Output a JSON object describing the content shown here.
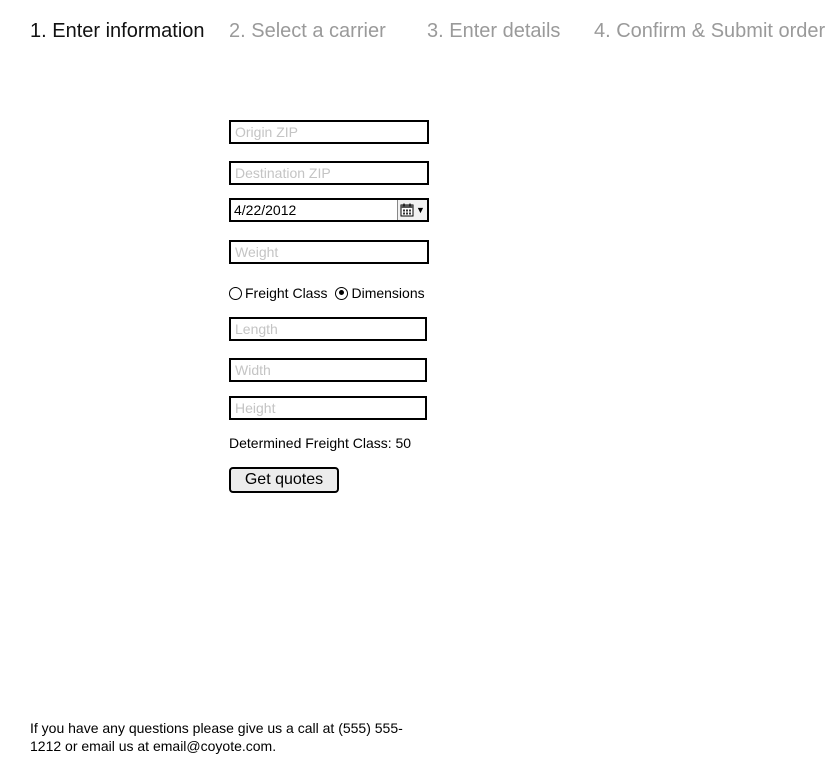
{
  "steps": [
    {
      "label": "1. Enter information",
      "active": true
    },
    {
      "label": "2. Select a carrier",
      "active": false
    },
    {
      "label": "3. Enter details",
      "active": false
    },
    {
      "label": "4. Confirm & Submit order",
      "active": false
    }
  ],
  "form": {
    "origin_zip": {
      "placeholder": "Origin ZIP",
      "value": ""
    },
    "destination_zip": {
      "placeholder": "Destination ZIP",
      "value": ""
    },
    "ship_date": {
      "value": "4/22/2012",
      "icon": "calendar-icon"
    },
    "weight": {
      "placeholder": "Weight",
      "value": ""
    },
    "measure_mode": {
      "options": [
        {
          "label": "Freight Class",
          "selected": false
        },
        {
          "label": "Dimensions",
          "selected": true
        }
      ]
    },
    "length": {
      "placeholder": "Length",
      "value": ""
    },
    "width": {
      "placeholder": "Width",
      "value": ""
    },
    "height": {
      "placeholder": "Height",
      "value": ""
    },
    "determined_class_text": "Determined Freight Class: 50",
    "submit_label": "Get quotes"
  },
  "footer": {
    "text": "If you have any questions please give us a call at (555) 555-1212 or email us at email@coyote.com."
  },
  "colors": {
    "active_step": "#111111",
    "inactive_step": "#9a9a9a",
    "placeholder": "#c4c4c4",
    "button_bg": "#ececec"
  }
}
